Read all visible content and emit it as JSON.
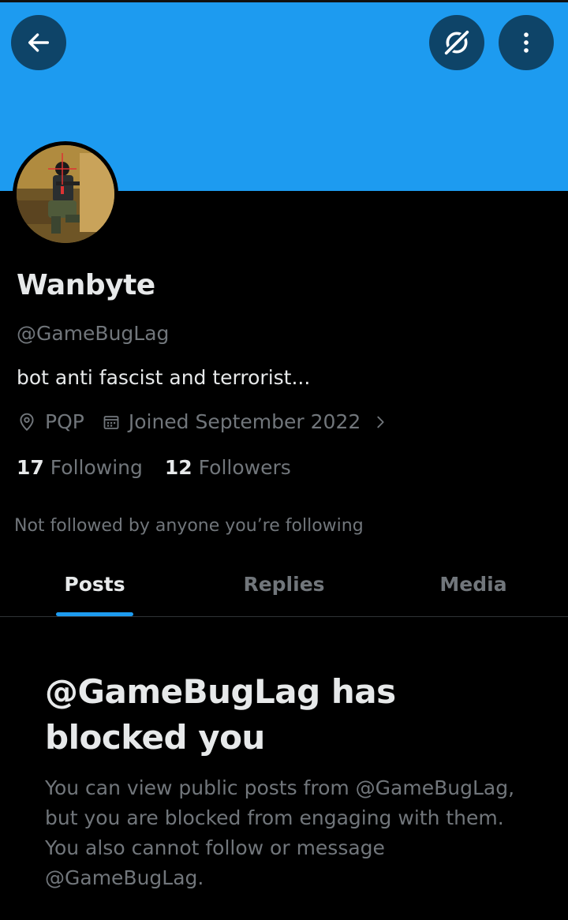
{
  "header": {
    "back_icon": "arrow-left-icon",
    "grok_icon": "grok-icon",
    "more_icon": "more-vertical-icon",
    "banner_color": "#1d9bf0"
  },
  "profile": {
    "display_name": "Wanbyte",
    "handle": "@GameBugLag",
    "bio": "bot anti fascist and terrorist...",
    "location": "PQP",
    "joined": "Joined September 2022",
    "following_count": "17",
    "following_label": "Following",
    "followers_count": "12",
    "followers_label": "Followers",
    "not_followed_text": "Not followed by anyone you’re following"
  },
  "tabs": [
    {
      "label": "Posts",
      "active": true
    },
    {
      "label": "Replies",
      "active": false
    },
    {
      "label": "Media",
      "active": false
    }
  ],
  "blocked": {
    "title": "@GameBugLag has blocked you",
    "description": "You can view public posts from @GameBugLag, but you are blocked from engaging with them. You also cannot follow or message @GameBugLag."
  },
  "colors": {
    "accent": "#1d9bf0",
    "text_primary": "#e7e9ea",
    "text_secondary": "#71767b",
    "background": "#000000"
  }
}
